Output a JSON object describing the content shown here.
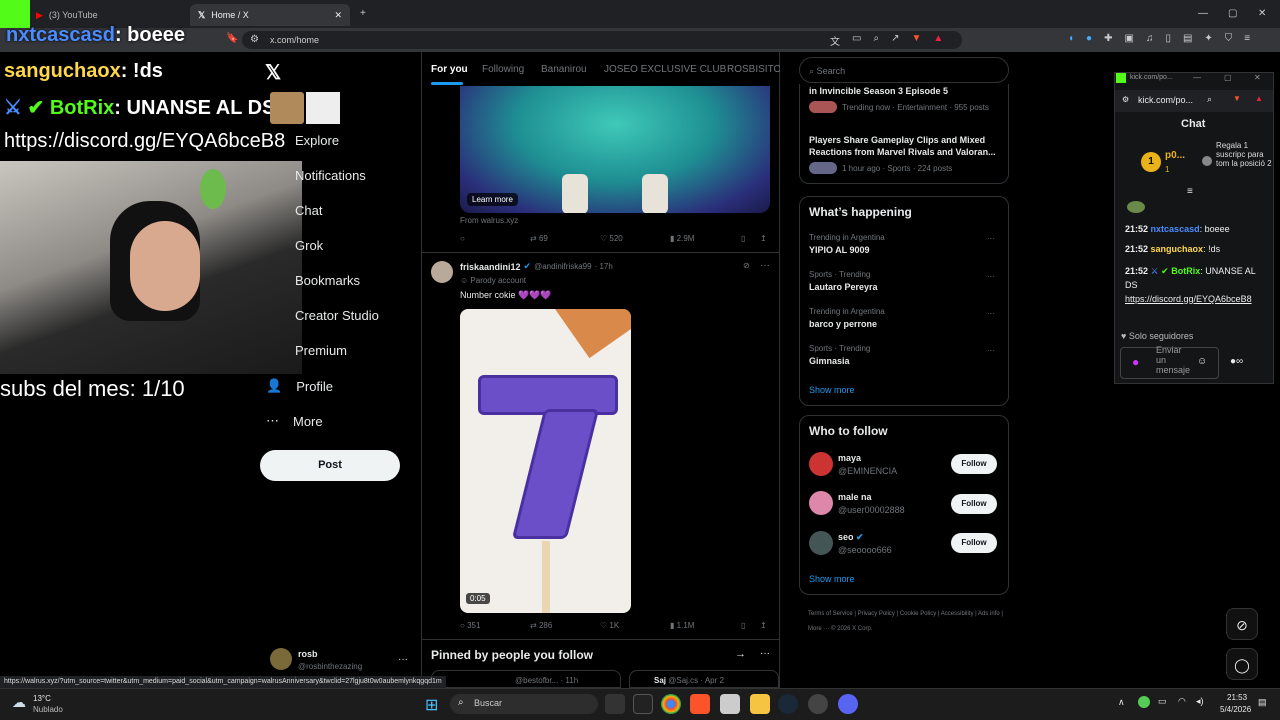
{
  "browser": {
    "tabs": [
      {
        "label": "(3) YouTube"
      },
      {
        "label": "Home / X"
      }
    ],
    "url": "x.com/home"
  },
  "stream_overlay": {
    "lines": [
      {
        "user": "nxtcascasd",
        "text": ": boeee"
      },
      {
        "user": "sanguchaox",
        "text": ": !ds"
      },
      {
        "user": "BotRix",
        "text": ": UNANSE AL DS"
      },
      {
        "user": "",
        "text": "https://discord.gg/EYQA6bceB8"
      }
    ],
    "subs": "subs del mes: 1/10"
  },
  "x_nav": {
    "items": [
      {
        "label": "Explore"
      },
      {
        "label": "Notifications"
      },
      {
        "label": "Chat"
      },
      {
        "label": "Grok"
      },
      {
        "label": "Bookmarks"
      },
      {
        "label": "Creator Studio"
      },
      {
        "label": "Premium"
      },
      {
        "label": "Profile"
      },
      {
        "label": "More"
      }
    ],
    "post_label": "Post",
    "account": {
      "name": "rosb",
      "handle": "@rosbinthezazing"
    }
  },
  "feed": {
    "tabs": [
      "For you",
      "Following",
      "Bananirou",
      "JOSEO EXCLUSIVE CLUB",
      "ROSBISITOS"
    ],
    "ad": {
      "learn_more": "Learn more",
      "from": "From walrus.xyz",
      "retweets": "69",
      "likes": "520",
      "views": "2.9M"
    },
    "post": {
      "name": "friskaandini12",
      "handle": "@andinifriska99",
      "time": "· 17h",
      "parody": "Parody account",
      "text": "Number cokie 💜💜💜",
      "video_time": "0:05",
      "replies": "351",
      "retweets": "286",
      "likes": "1K",
      "views": "1.1M"
    },
    "pinned_title": "Pinned by people you follow",
    "pinned_preview": [
      {
        "handle": "@bestofbr...",
        "time": "· 11h"
      },
      {
        "name": "Saj",
        "handle": "@Saj.cs",
        "time": "· Apr 2"
      }
    ]
  },
  "right": {
    "search_placeholder": "Search",
    "top_trends": [
      {
        "title": "in Invincible Season 3 Episode 5",
        "meta": "Trending now · Entertainment · 955 posts"
      },
      {
        "title": "Players Share Gameplay Clips and Mixed Reactions from Marvel Rivals and Valoran...",
        "meta": "1 hour ago · Sports · 224 posts"
      }
    ],
    "happening_title": "What’s happening",
    "trends": [
      {
        "context": "Trending in Argentina",
        "name": "YIPIO AL 9009"
      },
      {
        "context": "Sports · Trending",
        "name": "Lautaro Pereyra"
      },
      {
        "context": "Trending in Argentina",
        "name": "barco y perrone"
      },
      {
        "context": "Sports · Trending",
        "name": "Gimnasia"
      }
    ],
    "show_more": "Show more",
    "who_title": "Who to follow",
    "follow": [
      {
        "name": "maya",
        "handle": "@EMINENCIA",
        "button": "Follow"
      },
      {
        "name": "male na",
        "handle": "@user00002888",
        "button": "Follow"
      },
      {
        "name": "seo",
        "handle": "@seoooo666",
        "button": "Follow"
      }
    ],
    "show_more2": "Show more",
    "footer": [
      "Terms of Service",
      "Privacy Policy",
      "Cookie Policy",
      "Accessibility",
      "Ads info",
      "More ···",
      "© 2026 X Corp."
    ]
  },
  "kick": {
    "title_url": "kick.com/po...",
    "url": "kick.com/po...",
    "chat_title": "Chat",
    "sub_user": "p0...",
    "sub_count": "1",
    "sub_promo": "Regala 1 suscripc para tom la posició 2",
    "messages": [
      {
        "time": "21:52",
        "user": "nxtcascasd",
        "text": ": boeee"
      },
      {
        "time": "21:52",
        "user": "sanguchaox",
        "text": ": !ds"
      },
      {
        "time": "21:52",
        "user": "BotRix",
        "text": ": UNANSE AL DS"
      },
      {
        "time": "",
        "user": "",
        "text": "https://discord.gg/EYQA6bceB8"
      }
    ],
    "followers_only": "Solo seguidores",
    "input_placeholder": "Enviar un mensaje"
  },
  "statusbar_url": "https://walrus.xyz/?utm_source=twitter&utm_medium=paid_social&utm_campaign=walrusAnniversary&twclid=27lgju8t0w0aubemlynkqgqd1m",
  "taskbar": {
    "weather_temp": "13°C",
    "weather_desc": "Nublado",
    "search_label": "Buscar",
    "time": "21:53",
    "date": "5/4/2026"
  },
  "colors": {
    "accent": "#1d9bf0",
    "kick_green": "#53fc18",
    "purple": "#7b4fd0"
  }
}
